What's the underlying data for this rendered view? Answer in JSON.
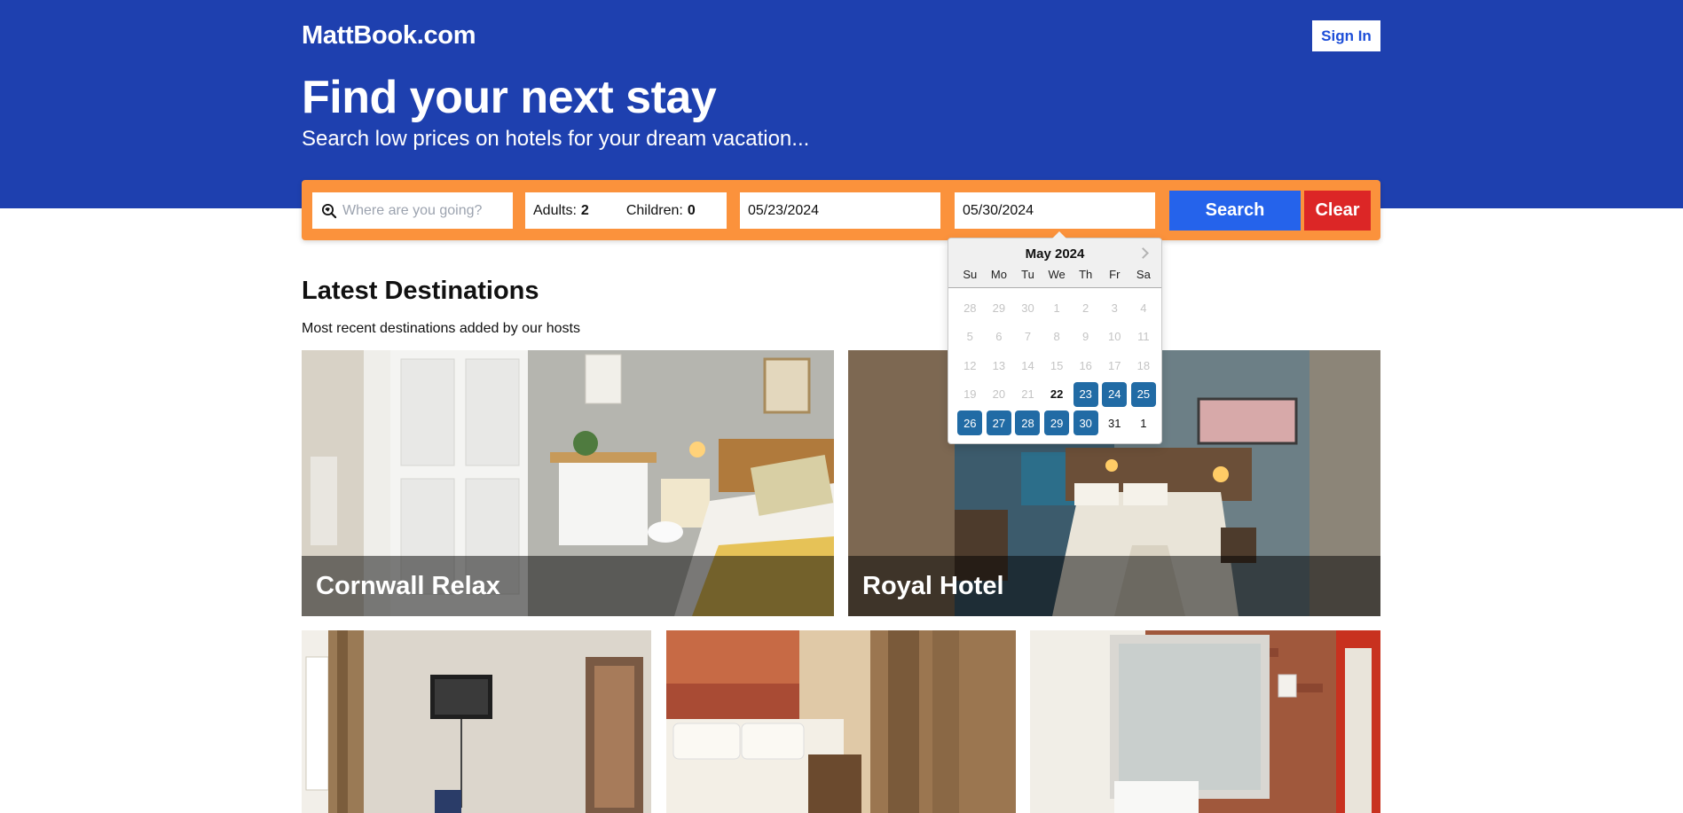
{
  "header": {
    "brand": "MattBook.com",
    "sign_in_label": "Sign In",
    "title": "Find your next stay",
    "subtitle": "Search low prices on hotels for your dream vacation..."
  },
  "search": {
    "destination_placeholder": "Where are you going?",
    "destination_value": "",
    "adults_label": "Adults:",
    "adults_value": "2",
    "children_label": "Children:",
    "children_value": "0",
    "check_in": "05/23/2024",
    "check_out": "05/30/2024",
    "search_label": "Search",
    "clear_label": "Clear"
  },
  "calendar": {
    "month": "May 2024",
    "weekdays": [
      "Su",
      "Mo",
      "Tu",
      "We",
      "Th",
      "Fr",
      "Sa"
    ],
    "weeks": [
      [
        "28",
        "29",
        "30",
        "1",
        "2",
        "3",
        "4"
      ],
      [
        "5",
        "6",
        "7",
        "8",
        "9",
        "10",
        "11"
      ],
      [
        "12",
        "13",
        "14",
        "15",
        "16",
        "17",
        "18"
      ],
      [
        "19",
        "20",
        "21",
        "22",
        "23",
        "24",
        "25"
      ],
      [
        "26",
        "27",
        "28",
        "29",
        "30",
        "31",
        "1"
      ]
    ],
    "today": "22",
    "selected_range": [
      "23",
      "24",
      "25",
      "26",
      "27",
      "28",
      "29",
      "30"
    ]
  },
  "latest": {
    "title": "Latest Destinations",
    "subtitle": "Most recent destinations added by our hosts",
    "hotels": [
      {
        "name": "Cornwall Relax"
      },
      {
        "name": "Royal Hotel"
      },
      {
        "name": ""
      },
      {
        "name": ""
      },
      {
        "name": ""
      }
    ]
  },
  "colors": {
    "hero_bg": "#1e40af",
    "search_bar": "#fb923c",
    "search_button": "#2563eb",
    "clear_button": "#dc2626",
    "calendar_selected": "#216ba5"
  },
  "icons": {
    "destination": "map-search-icon",
    "calendar_next": "chevron-right-icon"
  }
}
